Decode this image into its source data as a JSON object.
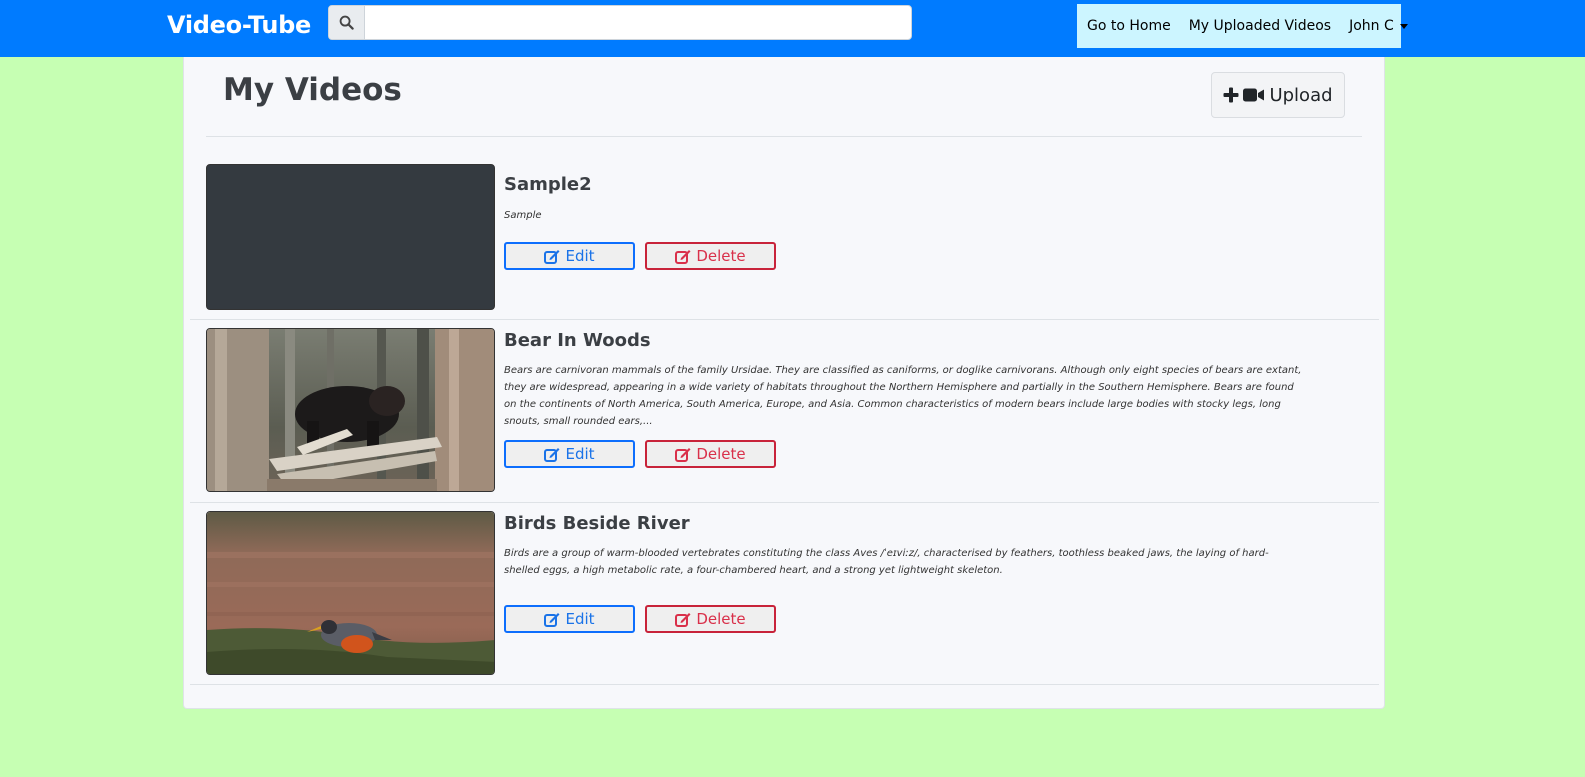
{
  "navbar": {
    "brand": "Video-Tube",
    "search": {
      "placeholder": "",
      "value": ""
    },
    "links": [
      "Go to Home",
      "My Uploaded Videos"
    ],
    "user": "John C"
  },
  "page": {
    "title": "My Videos",
    "upload_label": "Upload"
  },
  "videos": [
    {
      "title": "Sample2",
      "description": "Sample",
      "edit_label": "Edit",
      "delete_label": "Delete"
    },
    {
      "title": "Bear In Woods",
      "description": "Bears are carnivoran mammals of the family Ursidae. They are classified as caniforms, or doglike carnivorans. Although only eight species of bears are extant, they are widespread, appearing in a wide variety of habitats throughout the Northern Hemisphere and partially in the Southern Hemisphere. Bears are found on the continents of North America, South America, Europe, and Asia. Common characteristics of modern bears include large bodies with stocky legs, long snouts, small rounded ears,...",
      "edit_label": "Edit",
      "delete_label": "Delete"
    },
    {
      "title": "Birds Beside River",
      "description": "Birds are a group of warm-blooded vertebrates constituting the class Aves /ˈeɪviːz/, characterised by feathers, toothless beaked jaws, the laying of hard-shelled eggs, a high metabolic rate, a four-chambered heart, and a strong yet lightweight skeleton.",
      "edit_label": "Edit",
      "delete_label": "Delete"
    }
  ],
  "icons": {
    "search": "search-icon",
    "plus": "plus-icon",
    "video": "video-camera-icon",
    "edit": "edit-icon",
    "delete": "edit-icon"
  },
  "colors": {
    "navbar": "#007bff",
    "background": "#c6ffb3",
    "nav_links_bg": "#ccf5ff",
    "edit": "#0d6efd",
    "delete": "#c8233a"
  }
}
